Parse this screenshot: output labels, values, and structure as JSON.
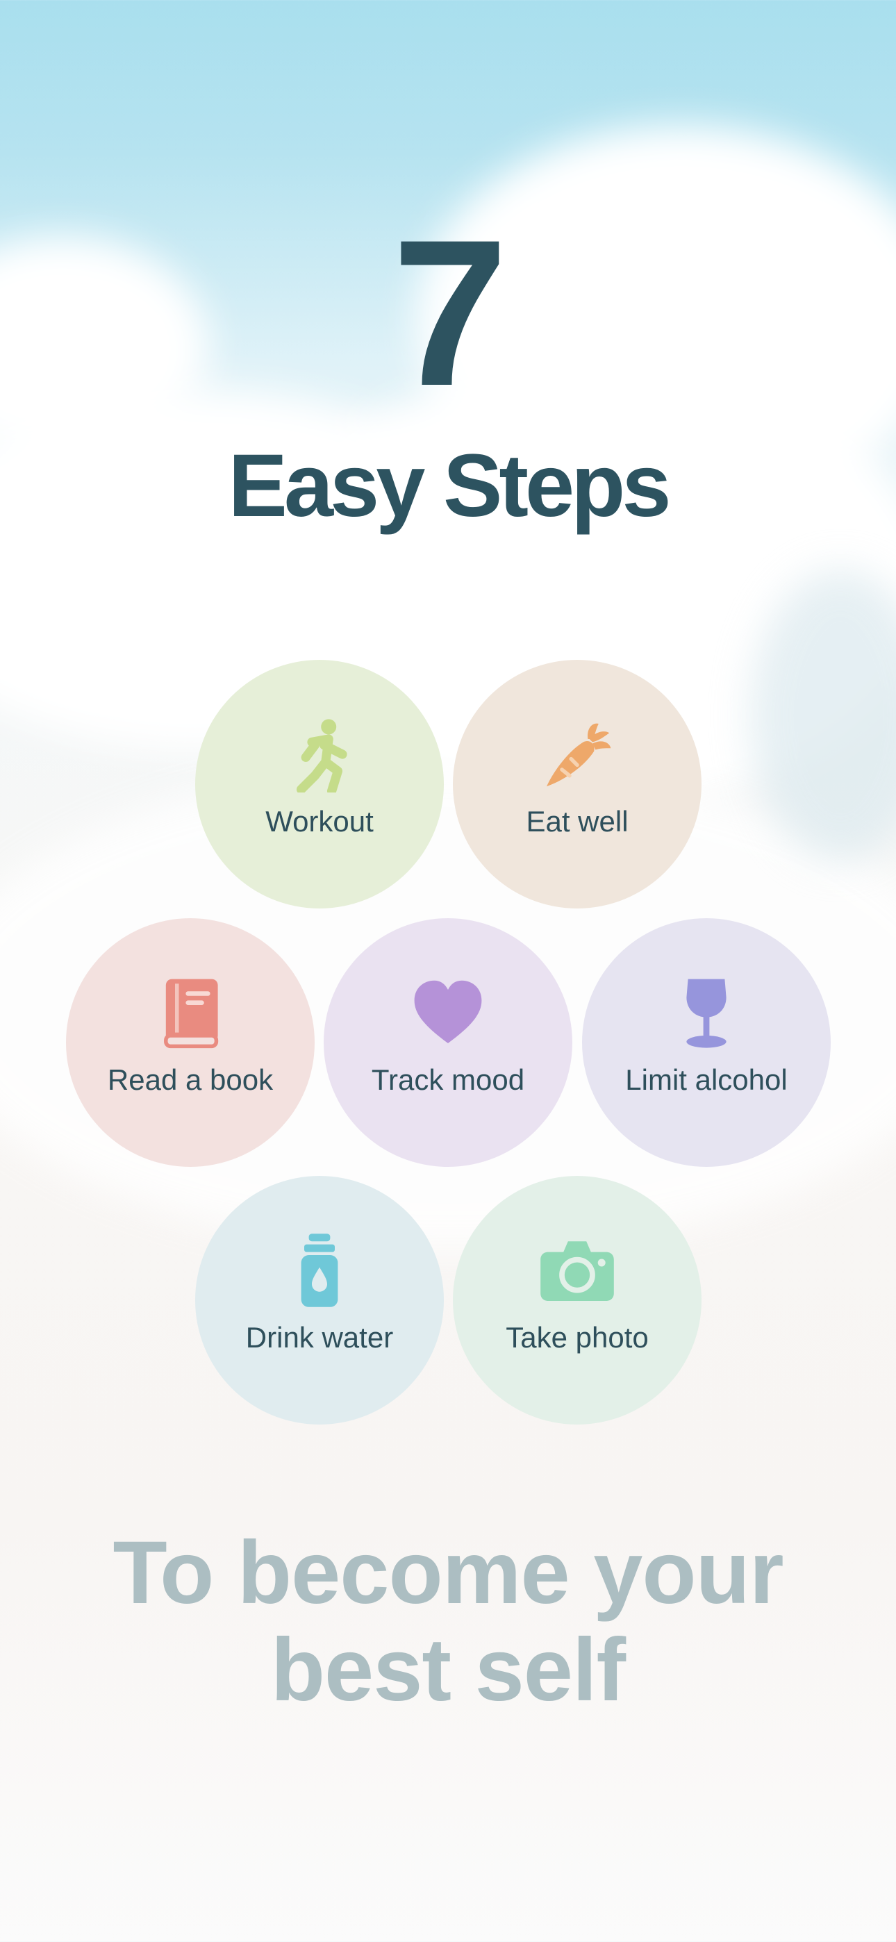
{
  "hero": {
    "number": "7",
    "subtitle": "Easy Steps"
  },
  "steps": [
    {
      "label": "Workout",
      "icon": "running-icon",
      "bg": "#e6efd8",
      "color": "#c5dc8a"
    },
    {
      "label": "Eat well",
      "icon": "carrot-icon",
      "bg": "#f0e6dc",
      "color": "#eea86a"
    },
    {
      "label": "Read a book",
      "icon": "book-icon",
      "bg": "#f3e1df",
      "color": "#e98b80"
    },
    {
      "label": "Track mood",
      "icon": "heart-icon",
      "bg": "#eae2f1",
      "color": "#b592d8"
    },
    {
      "label": "Limit alcohol",
      "icon": "wine-glass-icon",
      "bg": "#e6e4f1",
      "color": "#9695dc"
    },
    {
      "label": "Drink water",
      "icon": "water-bottle-icon",
      "bg": "#e0ecef",
      "color": "#6fc8d8"
    },
    {
      "label": "Take photo",
      "icon": "camera-icon",
      "bg": "#e3f0e8",
      "color": "#90d9b5"
    }
  ],
  "tagline": {
    "line1": "To become your",
    "line2": "best self"
  }
}
